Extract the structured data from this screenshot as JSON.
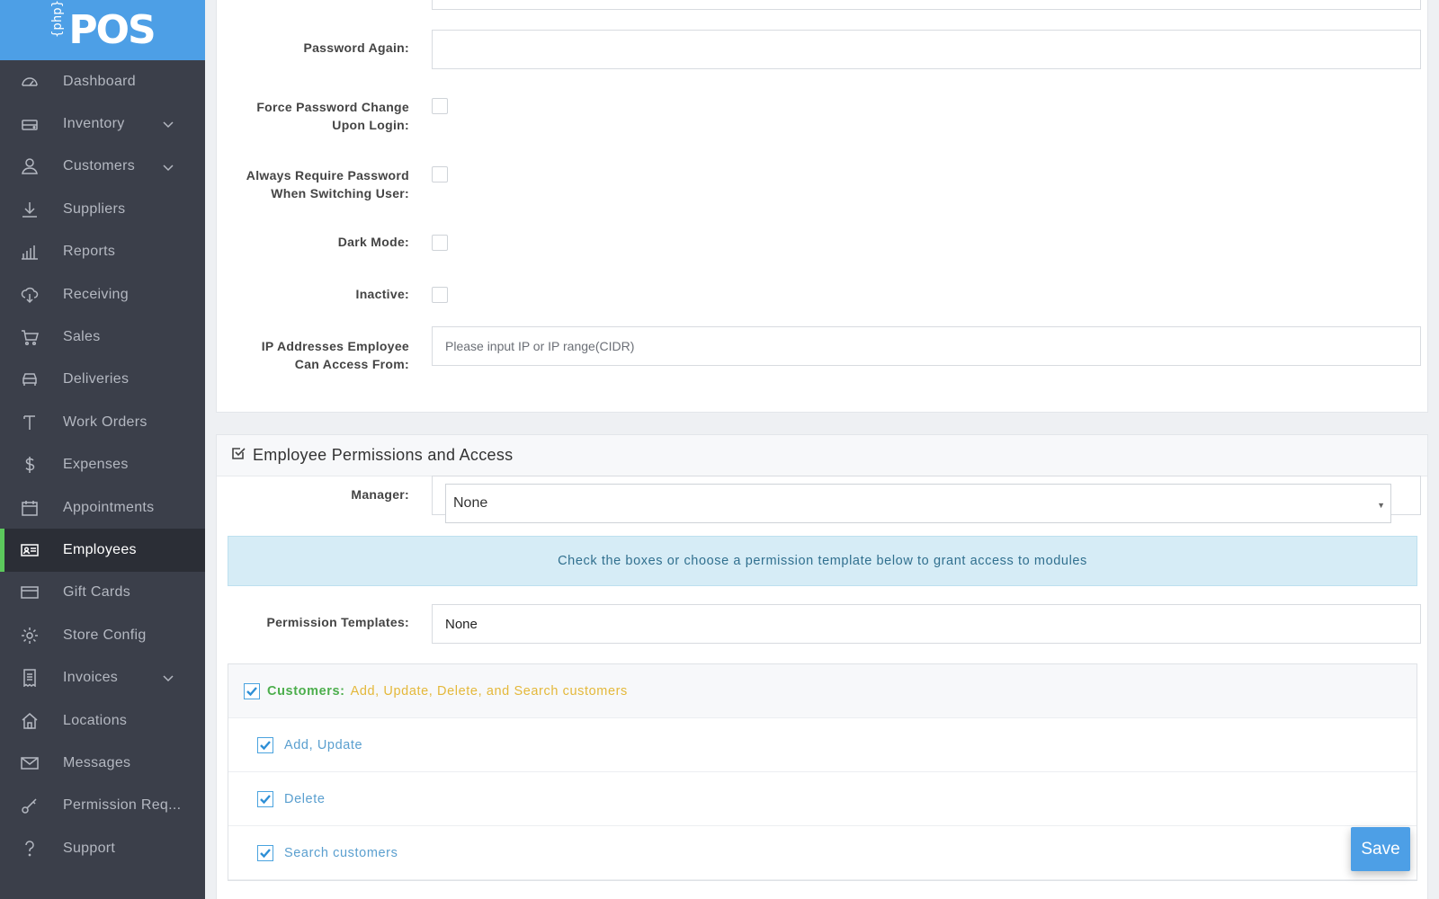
{
  "app": {
    "logo_prefix": "{php}",
    "logo_text": "POS",
    "brand_color": "#4d9fe6"
  },
  "sidebar": {
    "items": [
      {
        "label": "Dashboard",
        "icon": "dashboard-icon"
      },
      {
        "label": "Inventory",
        "icon": "inventory-icon",
        "has_submenu": true
      },
      {
        "label": "Customers",
        "icon": "customer-icon",
        "has_submenu": true
      },
      {
        "label": "Suppliers",
        "icon": "download-icon"
      },
      {
        "label": "Reports",
        "icon": "bar-chart-icon"
      },
      {
        "label": "Receiving",
        "icon": "cloud-download-icon"
      },
      {
        "label": "Sales",
        "icon": "cart-icon"
      },
      {
        "label": "Deliveries",
        "icon": "car-icon"
      },
      {
        "label": "Work Orders",
        "icon": "tool-icon"
      },
      {
        "label": "Expenses",
        "icon": "dollar-icon"
      },
      {
        "label": "Appointments",
        "icon": "calendar-icon"
      },
      {
        "label": "Employees",
        "icon": "id-card-icon",
        "active": true
      },
      {
        "label": "Gift Cards",
        "icon": "credit-card-icon"
      },
      {
        "label": "Store Config",
        "icon": "gear-icon"
      },
      {
        "label": "Invoices",
        "icon": "receipt-icon",
        "has_submenu": true
      },
      {
        "label": "Locations",
        "icon": "home-icon"
      },
      {
        "label": "Messages",
        "icon": "envelope-icon"
      },
      {
        "label": "Permission Req...",
        "icon": "key-icon"
      },
      {
        "label": "Support",
        "icon": "question-icon"
      }
    ],
    "active_accent": "#5cc95c"
  },
  "form": {
    "password_again_label": "Password Again:",
    "force_password_label_1": "Force Password Change",
    "force_password_label_2": "Upon Login:",
    "always_require_label_1": "Always Require Password",
    "always_require_label_2": "When Switching User:",
    "dark_mode_label": "Dark Mode:",
    "inactive_label": "Inactive:",
    "ip_label_1": "IP Addresses Employee",
    "ip_label_2": "Can Access From:",
    "ip_placeholder": "Please input IP or IP range(CIDR)"
  },
  "permissions": {
    "section_title": "Employee Permissions and Access",
    "manager_label": "Manager:",
    "manager_value": "None",
    "info_text": "Check the boxes or choose a permission template below to grant access to modules",
    "templates_label": "Permission Templates:",
    "templates_value": "None",
    "module": {
      "name": "Customers:",
      "description": "Add, Update, Delete, and Search customers",
      "checked": true,
      "actions": [
        {
          "label": "Add, Update",
          "checked": true
        },
        {
          "label": "Delete",
          "checked": true
        },
        {
          "label": "Search customers",
          "checked": true
        }
      ]
    }
  },
  "actions": {
    "save_label": "Save"
  }
}
